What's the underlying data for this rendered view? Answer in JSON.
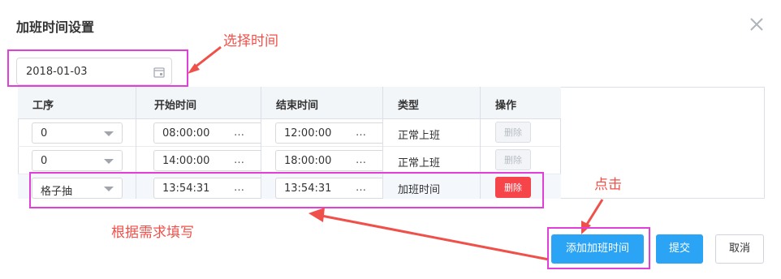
{
  "dialog": {
    "title": "加班时间设置"
  },
  "date": {
    "value": "2018-01-03"
  },
  "table": {
    "headers": [
      "工序",
      "开始时间",
      "结束时间",
      "类型",
      "操作"
    ],
    "rows": [
      {
        "process": "0",
        "start": "08:00:00",
        "start_more": "…",
        "end": "12:00:00",
        "end_more": "…",
        "type": "正常上班",
        "action": "删除",
        "action_enabled": false
      },
      {
        "process": "0",
        "start": "14:00:00",
        "start_more": "…",
        "end": "18:00:00",
        "end_more": "…",
        "type": "正常上班",
        "action": "删除",
        "action_enabled": false
      },
      {
        "process": "格子抽",
        "start": "13:54:31",
        "start_more": "…",
        "end": "13:54:31",
        "end_more": "…",
        "type": "加班时间",
        "action": "删除",
        "action_enabled": true
      }
    ]
  },
  "annotations": {
    "select_time": "选择时间",
    "fill_as_needed": "根据需求填写",
    "click": "点击"
  },
  "footer": {
    "add_overtime": "添加加班时间",
    "submit": "提交",
    "cancel": "取消"
  },
  "colors": {
    "primary": "#2ca4f5",
    "danger": "#f5454b",
    "annotation": "#f0504a",
    "highlight_box": "#e040d8"
  },
  "icons": {
    "close": "close-icon",
    "calendar": "calendar-icon",
    "dropdown": "chevron-down-icon"
  }
}
